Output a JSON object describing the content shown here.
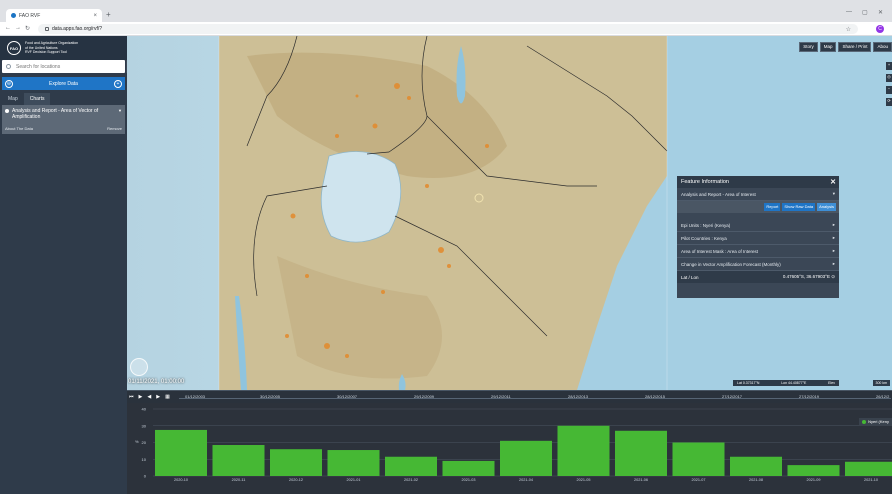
{
  "browser": {
    "tab_title": "FAO RVF",
    "url": "data.apps.fao.org/rvf/?",
    "profile_initial": "C"
  },
  "sidebar": {
    "org_line1": "Food and Agriculture Organization",
    "org_line2": "of the United Nations",
    "org_line3": "RVF Decision Support Tool",
    "search_placeholder": "Search for locations",
    "explore_label": "Explore Data",
    "tabs": [
      {
        "label": "Map"
      },
      {
        "label": "Charts"
      }
    ],
    "layer": {
      "title": "Analysis and Report - Area of Vector of Amplification",
      "about": "About The Data",
      "remove": "Remove"
    }
  },
  "map": {
    "toolbar": [
      {
        "label": "Story"
      },
      {
        "label": "Map"
      },
      {
        "label": "Share / Print"
      },
      {
        "label": "Abou"
      }
    ],
    "timestamp": "01/11/2021, 01:00:00",
    "coord_lat": "Lat  0.37317°N",
    "coord_lon": "Lon  44.40877°E",
    "coord_elev": "Elev",
    "scale": "300 km",
    "colors": {
      "water": "#b9d8e6",
      "lake": "#cfe5ee",
      "land": "#cbbc93",
      "hotspot": "#e38a2c"
    }
  },
  "feature_panel": {
    "title": "Feature Information",
    "layer_row": "Analysis and Report - Area of Interest",
    "actions": {
      "report": "Report",
      "raw": "Show Raw Data",
      "analysis": "Analysis"
    },
    "rows": [
      {
        "label": "Epi Units : Nyeri (Kenya)"
      },
      {
        "label": "Pilot Countries : Kenya"
      },
      {
        "label": "Area of Interest Mask : Area of Interest"
      },
      {
        "label": "Change in Vector Amplification Forecast (Monthly)"
      }
    ],
    "latlon_label": "Lat / Lon",
    "latlon_value": "0.47605°S, 36.67903°E"
  },
  "timeline": {
    "start": "01/12/2003",
    "ticks": [
      "30/12/2005",
      "30/12/2007",
      "29/12/2009",
      "29/12/2011",
      "28/12/2013",
      "28/12/2015",
      "27/12/2017",
      "27/12/2019",
      "26/12/2"
    ]
  },
  "chart_data": {
    "type": "bar",
    "categories": [
      "2020-10",
      "2020-11",
      "2020-12",
      "2021-01",
      "2021-02",
      "2021-03",
      "2021-04",
      "2021-05",
      "2021-06",
      "2021-07",
      "2021-08",
      "2021-09",
      "2021-10"
    ],
    "series": [
      {
        "name": "Nyeri (Keny",
        "values": [
          27.5,
          18.5,
          16,
          15.5,
          11.5,
          9,
          21,
          30,
          27,
          20,
          11.5,
          6.5,
          8.5
        ],
        "color": "#46b834"
      }
    ],
    "y_ticks": [
      "40",
      "30",
      "20",
      "10",
      "0"
    ],
    "ylabel": "%",
    "ylim": [
      0,
      40
    ],
    "grid": true,
    "legend": "top-right"
  }
}
